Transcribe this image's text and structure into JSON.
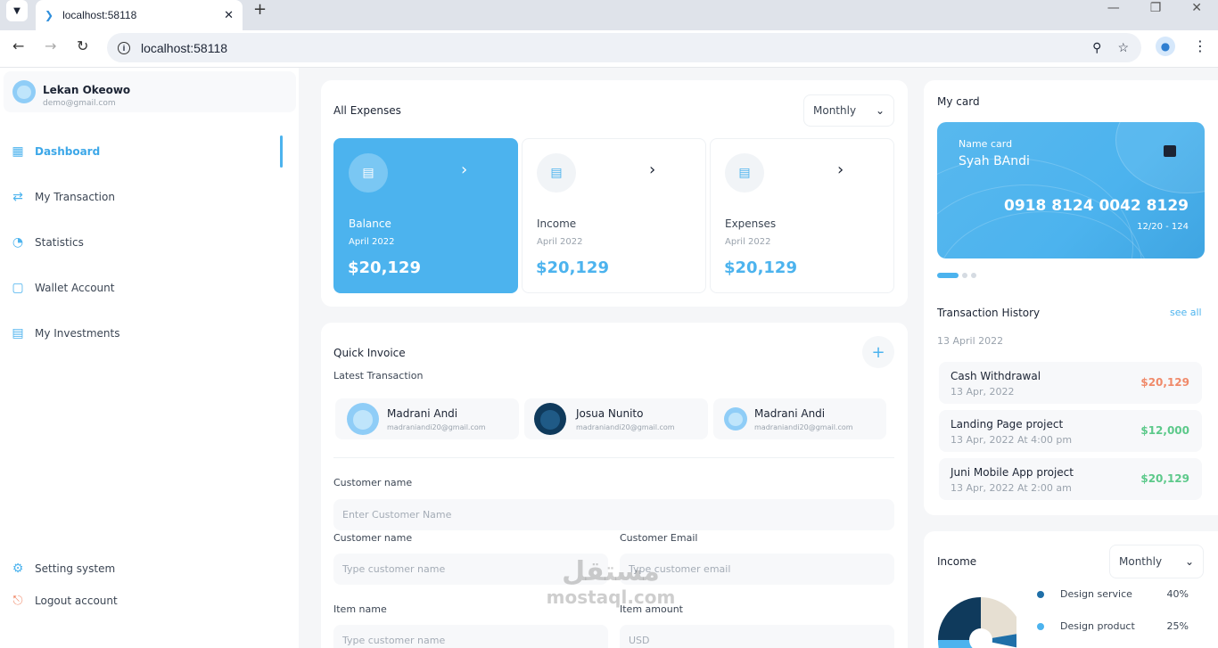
{
  "browser": {
    "tab_title": "localhost:58118",
    "url": "localhost:58118"
  },
  "sidebar": {
    "user_name": "Lekan Okeowo",
    "user_email": "demo@gmail.com",
    "items": [
      {
        "label": "Dashboard",
        "icon": "grid-icon"
      },
      {
        "label": "My Transaction",
        "icon": "transaction-icon"
      },
      {
        "label": "Statistics",
        "icon": "pie-chart-icon"
      },
      {
        "label": "Wallet Account",
        "icon": "wallet-icon"
      },
      {
        "label": "My Investments",
        "icon": "investment-icon"
      }
    ],
    "bottom_items": [
      {
        "label": "Setting system",
        "icon": "gear-icon"
      },
      {
        "label": "Logout account",
        "icon": "logout-icon"
      }
    ]
  },
  "expenses": {
    "title": "All Expenses",
    "period": "Monthly",
    "cards": [
      {
        "label": "Balance",
        "date": "April 2022",
        "amount": "$20,129"
      },
      {
        "label": "Income",
        "date": "April 2022",
        "amount": "$20,129"
      },
      {
        "label": "Expenses",
        "date": "April 2022",
        "amount": "$20,129"
      }
    ]
  },
  "invoice": {
    "title": "Quick Invoice",
    "subtitle": "Latest Transaction",
    "contacts": [
      {
        "name": "Madrani Andi",
        "email": "madraniandi20@gmail.com"
      },
      {
        "name": "Josua Nunito",
        "email": "madraniandi20@gmail.com"
      },
      {
        "name": "Madrani Andi",
        "email": "madraniandi20@gmail.com"
      }
    ],
    "customer_name_label": "Customer name",
    "customer_name_placeholder": "Enter Customer Name",
    "customer_name_label_2": "Customer name",
    "customer_name_placeholder_2": "Type customer name",
    "customer_email_label": "Customer Email",
    "customer_email_placeholder": "Type customer email",
    "item_name_label": "Item name",
    "item_name_placeholder": "Type customer name",
    "item_amount_label": "Item amount",
    "item_amount_placeholder": "USD"
  },
  "my_card": {
    "title": "My card",
    "label": "Name card",
    "holder": "Syah BAndi",
    "number": "0918 8124 0042 8129",
    "expiry": "12/20 - 124"
  },
  "history": {
    "title": "Transaction History",
    "see_all": "see all",
    "date": "13 April 2022",
    "items": [
      {
        "name": "Cash Withdrawal",
        "date": "13 Apr, 2022",
        "amount": "$20,129",
        "color": "#f08a6a"
      },
      {
        "name": "Landing Page project",
        "date": "13 Apr, 2022 At 4:00 pm",
        "amount": "$12,000",
        "color": "#5cc98a"
      },
      {
        "name": "Juni Mobile App project",
        "date": "13 Apr, 2022 At 2:00 am",
        "amount": "$20,129",
        "color": "#5cc98a"
      }
    ]
  },
  "income": {
    "title": "Income",
    "period": "Monthly",
    "legend": [
      {
        "label": "Design service",
        "pct": "40%",
        "color": "#1f6fa8"
      },
      {
        "label": "Design product",
        "pct": "25%",
        "color": "#4cb3ee"
      }
    ]
  },
  "watermark": {
    "text": "مستقل",
    "sub": "mostaql.com"
  },
  "colors": {
    "accent": "#4cb3ee",
    "dark": "#1c2434"
  }
}
